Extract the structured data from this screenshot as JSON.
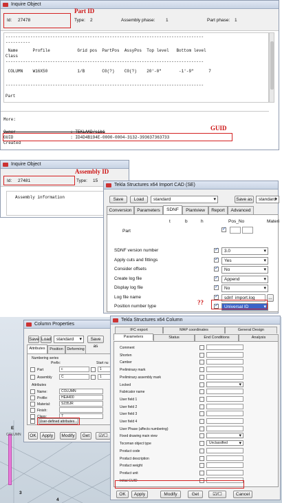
{
  "panel1": {
    "title": "Inquire Object",
    "id_label": "Id:",
    "id_value": "27478",
    "type_label": "Type:",
    "type_value": "2",
    "assembly_phase_label": "Assembly phase:",
    "assembly_phase_value": "1",
    "part_phase_label": "Part phase:",
    "part_phase_value": "1",
    "annotation": "Part ID",
    "sep_line": "--------------------------------------------------------------------------------",
    "short_dash": "----------",
    "col_line": " Name      Profile           Grid pos  PartPos  AssyPos  Top level   Bottom level",
    "class_label": "Class",
    "row_line": " COLUMN    W16X50            1/B       C0(?)    C0(?)    20'-0\"       -1'-9\"      7",
    "part_label": "Part",
    "more_label": "More:",
    "owner_line": "Owner                      : TEKLAAD/sib1",
    "guid_line": "GUID                       : ID4D4B194E-0000-0004-3132-393637363733",
    "created_line": "Created",
    "guid_annotation": "GUID"
  },
  "panel2": {
    "title": "Inquire Object",
    "annotation": "Assembly ID",
    "id_label": "Id:",
    "id_value": "27481",
    "type_label": "Type:",
    "type_value": "15",
    "assembly_info": "Assembly information"
  },
  "panel3": {
    "title": "Tekla Structures x64  Import CAD (SE)",
    "save_label": "Save",
    "load_label": "Load",
    "preset_value": "standard",
    "save_as_label": "Save as",
    "save_as_value": "standard",
    "tabs": [
      "Conversion",
      "Parameters",
      "SDNF",
      "Plantview",
      "Report",
      "Advanced"
    ],
    "col_t": "t",
    "col_b": "b",
    "col_h": "h",
    "col_posno": "Pos_No",
    "col_material": "Materi",
    "part_label": "Part",
    "rows": [
      {
        "label": "SDNF version number",
        "value": "3.0"
      },
      {
        "label": "Apply cuts and fittings",
        "value": "Yes"
      },
      {
        "label": "Consider offsets",
        "value": "No"
      },
      {
        "label": "Create log file",
        "value": "Append"
      },
      {
        "label": "Display log file",
        "value": "No"
      },
      {
        "label": "Log file name",
        "value": "sdnf_import.log"
      },
      {
        "label": "Position number type",
        "value": "Universal ID"
      }
    ],
    "browse_label": "...",
    "question_annotation": "??"
  },
  "panel4": {
    "title": "Column Properties",
    "save_label": "Save",
    "load_label": "Load",
    "preset_value": "standard",
    "save_as_label": "Save as",
    "tabs": [
      "Attributes",
      "Position",
      "Deforming"
    ],
    "numbering_series": "Numbering series",
    "prefix_label": "Prefix:",
    "start_label": "Start nu",
    "part_label": "Part",
    "part_prefix": "c",
    "part_start": "1",
    "assembly_label": "Assembly",
    "assembly_prefix": "C",
    "assembly_start": "1",
    "attributes_label": "Attributes",
    "name_label": "Name:",
    "name_value": "COLUMN",
    "profile_label": "Profile:",
    "profile_value": "HEA400",
    "material_label": "Material:",
    "material_value": "S235JR",
    "finish_label": "Finish:",
    "finish_value": "",
    "class_label": "Class:",
    "class_value": "7",
    "uda_button": "User-defined attributes...",
    "ok_label": "OK",
    "apply_label": "Apply",
    "modify_label": "Modify",
    "get_label": "Get",
    "toggle_label": "☑/☐",
    "axis_e": "E",
    "axis_3": "3",
    "axis_4": "4",
    "col_small_label": "COLUMN"
  },
  "panel5": {
    "title": "Tekla Structures x64  Column",
    "tabs_row1": [
      "IFC export",
      "MAP coordinates",
      "General Design"
    ],
    "tabs_row2": [
      "Parameters",
      "Status",
      "End Conditions",
      "Analysis"
    ],
    "fields": [
      {
        "label": "Comment",
        "type": "text",
        "value": ""
      },
      {
        "label": "Shorten",
        "type": "text",
        "value": ""
      },
      {
        "label": "Camber",
        "type": "text",
        "value": ""
      },
      {
        "label": "Preliminary mark",
        "type": "text",
        "value": ""
      },
      {
        "label": "Preliminary assembly mark",
        "type": "text",
        "value": ""
      },
      {
        "label": "Locked",
        "type": "select",
        "value": ""
      },
      {
        "label": "Fabricator name",
        "type": "text",
        "value": ""
      },
      {
        "label": "User field 1",
        "type": "text",
        "value": ""
      },
      {
        "label": "User field 2",
        "type": "text",
        "value": ""
      },
      {
        "label": "User field 3",
        "type": "text",
        "value": ""
      },
      {
        "label": "User field 4",
        "type": "text",
        "value": ""
      },
      {
        "label": "User Phase    (affects numbering)",
        "type": "text",
        "value": ""
      },
      {
        "label": "Fixed drawing main view",
        "type": "select",
        "value": ""
      },
      {
        "label": "Tocoman object type",
        "type": "select",
        "value": "Unclassified"
      },
      {
        "label": "Product code",
        "type": "text",
        "value": ""
      },
      {
        "label": "Product description",
        "type": "text",
        "value": ""
      },
      {
        "label": "Product weight",
        "type": "text",
        "value": ""
      },
      {
        "label": "Product unit",
        "type": "text",
        "value": ""
      },
      {
        "label": "Initial GUID",
        "type": "text",
        "value": ""
      }
    ],
    "ok_label": "OK",
    "apply_label": "Apply",
    "modify_label": "Modify",
    "get_label": "Get",
    "toggle_label": "☑/☐",
    "cancel_label": "Cancel"
  },
  "colors": {
    "annotation_red": "#cc1111",
    "highlight_blue": "#3a64c8",
    "column_pink": "#e87bd9"
  }
}
